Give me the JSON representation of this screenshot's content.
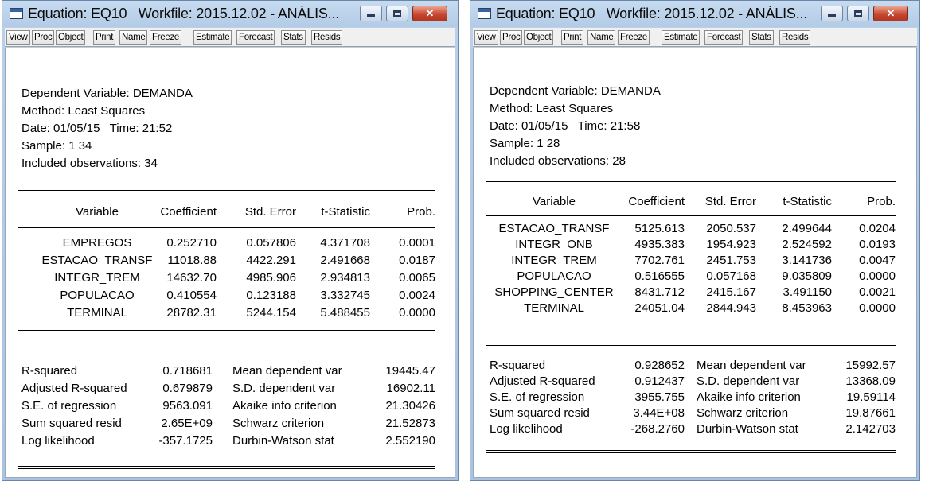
{
  "windows": [
    {
      "title": "Equation: EQ10   Workfile: 2015.12.02 - ANÁLIS...",
      "toolbar": [
        "View",
        "Proc",
        "Object",
        "Print",
        "Name",
        "Freeze",
        "Estimate",
        "Forecast",
        "Stats",
        "Resids"
      ],
      "header": [
        "Dependent Variable: DEMANDA",
        "Method: Least Squares",
        "Date: 01/05/15   Time: 21:52",
        "Sample: 1 34",
        "Included observations: 34"
      ],
      "columns": [
        "Variable",
        "Coefficient",
        "Std. Error",
        "t-Statistic",
        "Prob."
      ],
      "rows": [
        [
          "EMPREGOS",
          "0.252710",
          "0.057806",
          "4.371708",
          "0.0001"
        ],
        [
          "ESTACAO_TRANSF",
          "11018.88",
          "4422.291",
          "2.491668",
          "0.0187"
        ],
        [
          "INTEGR_TREM",
          "14632.70",
          "4985.906",
          "2.934813",
          "0.0065"
        ],
        [
          "POPULACAO",
          "0.410554",
          "0.123188",
          "3.332745",
          "0.0024"
        ],
        [
          "TERMINAL",
          "28782.31",
          "5244.154",
          "5.488455",
          "0.0000"
        ]
      ],
      "stats": [
        [
          "R-squared",
          "0.718681",
          "Mean dependent var",
          "19445.47"
        ],
        [
          "Adjusted R-squared",
          "0.679879",
          "S.D. dependent var",
          "16902.11"
        ],
        [
          "S.E. of regression",
          "9563.091",
          "Akaike info criterion",
          "21.30426"
        ],
        [
          "Sum squared resid",
          "2.65E+09",
          "Schwarz criterion",
          "21.52873"
        ],
        [
          "Log likelihood",
          "-357.1725",
          "Durbin-Watson stat",
          "2.552190"
        ]
      ]
    },
    {
      "title": "Equation: EQ10   Workfile: 2015.12.02 - ANÁLIS...",
      "toolbar": [
        "View",
        "Proc",
        "Object",
        "Print",
        "Name",
        "Freeze",
        "Estimate",
        "Forecast",
        "Stats",
        "Resids"
      ],
      "header": [
        "Dependent Variable: DEMANDA",
        "Method: Least Squares",
        "Date: 01/05/15   Time: 21:58",
        "Sample: 1 28",
        "Included observations: 28"
      ],
      "columns": [
        "Variable",
        "Coefficient",
        "Std. Error",
        "t-Statistic",
        "Prob."
      ],
      "rows": [
        [
          "ESTACAO_TRANSF",
          "5125.613",
          "2050.537",
          "2.499644",
          "0.0204"
        ],
        [
          "INTEGR_ONB",
          "4935.383",
          "1954.923",
          "2.524592",
          "0.0193"
        ],
        [
          "INTEGR_TREM",
          "7702.761",
          "2451.753",
          "3.141736",
          "0.0047"
        ],
        [
          "POPULACAO",
          "0.516555",
          "0.057168",
          "9.035809",
          "0.0000"
        ],
        [
          "SHOPPING_CENTER",
          "8431.712",
          "2415.167",
          "3.491150",
          "0.0021"
        ],
        [
          "TERMINAL",
          "24051.04",
          "2844.943",
          "8.453963",
          "0.0000"
        ]
      ],
      "stats": [
        [
          "R-squared",
          "0.928652",
          "Mean dependent var",
          "15992.57"
        ],
        [
          "Adjusted R-squared",
          "0.912437",
          "S.D. dependent var",
          "13368.09"
        ],
        [
          "S.E. of regression",
          "3955.755",
          "Akaike info criterion",
          "19.59114"
        ],
        [
          "Sum squared resid",
          "3.44E+08",
          "Schwarz criterion",
          "19.87661"
        ],
        [
          "Log likelihood",
          "-268.2760",
          "Durbin-Watson stat",
          "2.142703"
        ]
      ]
    }
  ],
  "icons": {
    "window": "window-icon",
    "minimize": "minimize-icon",
    "maximize": "maximize-icon",
    "close": "close-icon"
  },
  "colors": {
    "titlebar": "#b9d1ea",
    "close_button": "#c74630",
    "content_bg": "#ffffff"
  }
}
